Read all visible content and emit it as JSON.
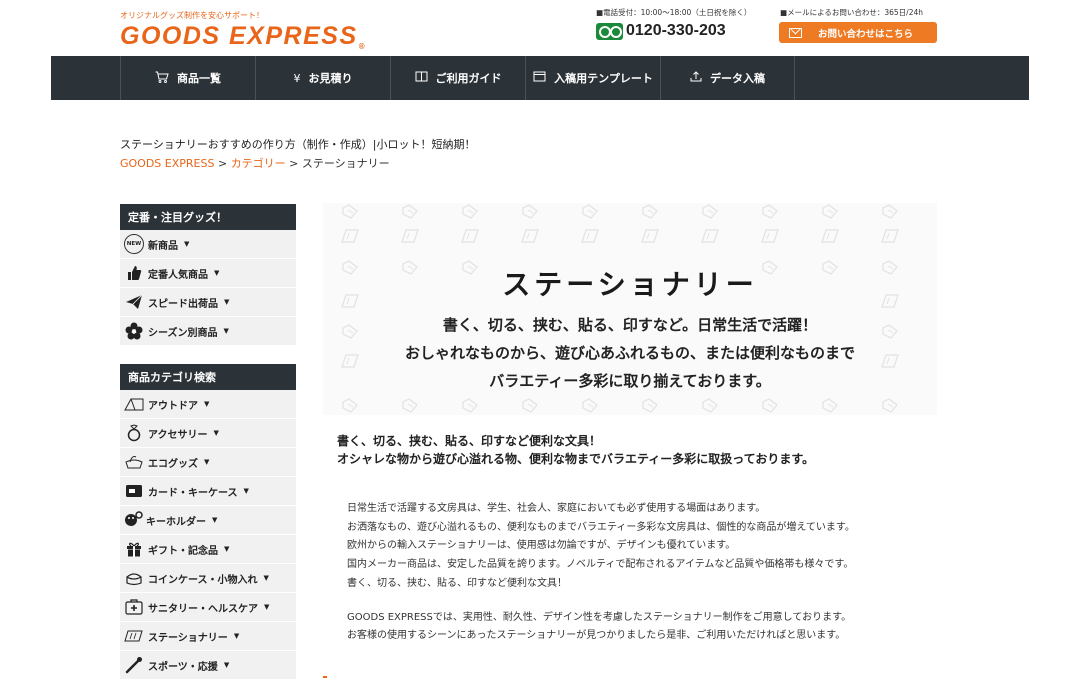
{
  "header": {
    "tagline": "オリジナルグッズ制作を安心サポート！",
    "logo": "GOODS EXPRESS",
    "logo_mark": "®",
    "tel_info": "■電話受付：10:00〜18:00（土日祝を除く）",
    "tel_number": "0120-330-203",
    "mail_info": "■メールによるお問い合わせ：365日/24h",
    "mail_button": "お問い合わせはこちら"
  },
  "nav": {
    "items": [
      {
        "label": "商品一覧",
        "icon": "cart-icon",
        "glyph": "🛒"
      },
      {
        "label": "お見積り",
        "icon": "yen-icon",
        "glyph": "¥"
      },
      {
        "label": "ご利用ガイド",
        "icon": "book-icon",
        "glyph": "📖"
      },
      {
        "label": "入稿用テンプレート",
        "icon": "template-icon",
        "glyph": "❐"
      },
      {
        "label": "データ入稿",
        "icon": "upload-icon",
        "glyph": "⇧"
      }
    ]
  },
  "page": {
    "title": "ステーショナリーおすすめの作り方（制作・作成）|小ロット！短納期！",
    "breadcrumb": {
      "home": "GOODS EXPRESS",
      "sep": " > ",
      "category": "カテゴリー",
      "current": "ステーショナリー"
    }
  },
  "sidebar": {
    "featured_heading": "定番・注目グッズ！",
    "featured": [
      {
        "label": "新商品",
        "icon": "new-badge-icon",
        "glyph": "NEW"
      },
      {
        "label": "定番人気商品",
        "icon": "thumbs-up-icon",
        "glyph": "👍"
      },
      {
        "label": "スピード出荷品",
        "icon": "paper-plane-icon",
        "glyph": "✈"
      },
      {
        "label": "シーズン別商品",
        "icon": "flower-icon",
        "glyph": "✿"
      }
    ],
    "category_heading": "商品カテゴリ検索",
    "categories": [
      {
        "label": "アウトドア",
        "icon": "tent-icon",
        "glyph": "⛺"
      },
      {
        "label": "アクセサリー",
        "icon": "ring-icon",
        "glyph": "💍"
      },
      {
        "label": "エコグッズ",
        "icon": "eco-bag-icon",
        "glyph": "♻"
      },
      {
        "label": "カード・キーケース",
        "icon": "card-case-icon",
        "glyph": "💳"
      },
      {
        "label": "キーホルダー",
        "icon": "keychain-icon",
        "glyph": "🔑"
      },
      {
        "label": "ギフト・記念品",
        "icon": "gift-icon",
        "glyph": "🎁"
      },
      {
        "label": "コインケース・小物入れ",
        "icon": "coin-purse-icon",
        "glyph": "👛"
      },
      {
        "label": "サニタリー・ヘルスケア",
        "icon": "first-aid-icon",
        "glyph": "✚"
      },
      {
        "label": "ステーショナリー",
        "icon": "notebook-icon",
        "glyph": "📒"
      },
      {
        "label": "スポーツ・応援",
        "icon": "baton-icon",
        "glyph": "✎"
      }
    ],
    "caret": "▼"
  },
  "hero": {
    "title": "ステーショナリー",
    "line1": "書く、切る、挟む、貼る、印すなど。日常生活で活躍！",
    "line2": "おしゃれなものから、遊び心あふれるもの、または便利なものまで",
    "line3": "バラエティー多彩に取り揃えております。"
  },
  "lead": {
    "line1": "書く、切る、挟む、貼る、印すなど便利な文具！",
    "line2": "オシャレな物から遊び心溢れる物、便利な物までバラエティー多彩に取扱っております。"
  },
  "body": {
    "p1": "日常生活で活躍する文房具は、学生、社会人、家庭においても必ず使用する場面はあります。",
    "p2": "お洒落なもの、遊び心溢れるもの、便利なものまでバラエティー多彩な文房具は、個性的な商品が増えています。",
    "p3": "欧州からの輸入ステーショナリーは、使用感は勿論ですが、デザインも優れています。",
    "p4": "国内メーカー商品は、安定した品質を誇ります。ノベルティで配布されるアイテムなど品質や価格帯も様々です。",
    "p5": "書く、切る、挟む、貼る、印すなど便利な文具！",
    "p6": "GOODS EXPRESSでは、実用性、耐久性、デザイン性を考慮したステーショナリー制作をご用意しております。",
    "p7": "お客様の使用するシーンにあったステーショナリーが見つかりましたら是非、ご利用いただければと思います。"
  },
  "colors": {
    "brand": "#e8651a",
    "nav_bg": "#2c3338",
    "highlight": "#f5d36b"
  }
}
